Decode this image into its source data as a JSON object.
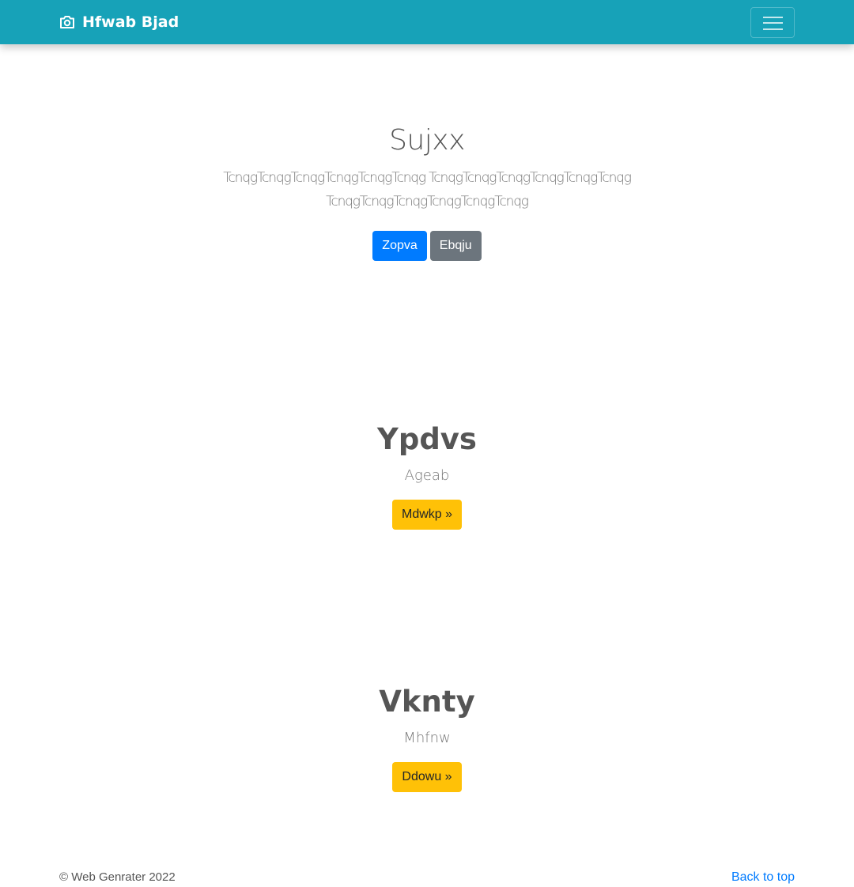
{
  "navbar": {
    "brand_icon": "camera-icon",
    "brand_text": "Hfwab Bjad",
    "toggler_icon": "hamburger-menu-icon",
    "background_color": "#17a2b8"
  },
  "hero": {
    "title": "Sujxx",
    "lead": "TcnqgTcnqgTcnqgTcnqgTcnqgTcnqg TcnqgTcnqgTcnqgTcnqgTcnqgTcnqg TcnqgTcnqgTcnqgTcnqgTcnqgTcnqg",
    "primary_button": "Zopva",
    "secondary_button": "Ebqju"
  },
  "sections": [
    {
      "title": "Ypdvs",
      "subtitle": "Ageab",
      "button": "Mdwkp »"
    },
    {
      "title": "Vknty",
      "subtitle": "Mhfnw",
      "button": "Ddowu »"
    }
  ],
  "footer": {
    "copyright": "© Web Genrater 2022",
    "back_to_top": "Back to top"
  },
  "colors": {
    "primary": "#007bff",
    "secondary": "#6c757d",
    "warning": "#ffc107"
  }
}
